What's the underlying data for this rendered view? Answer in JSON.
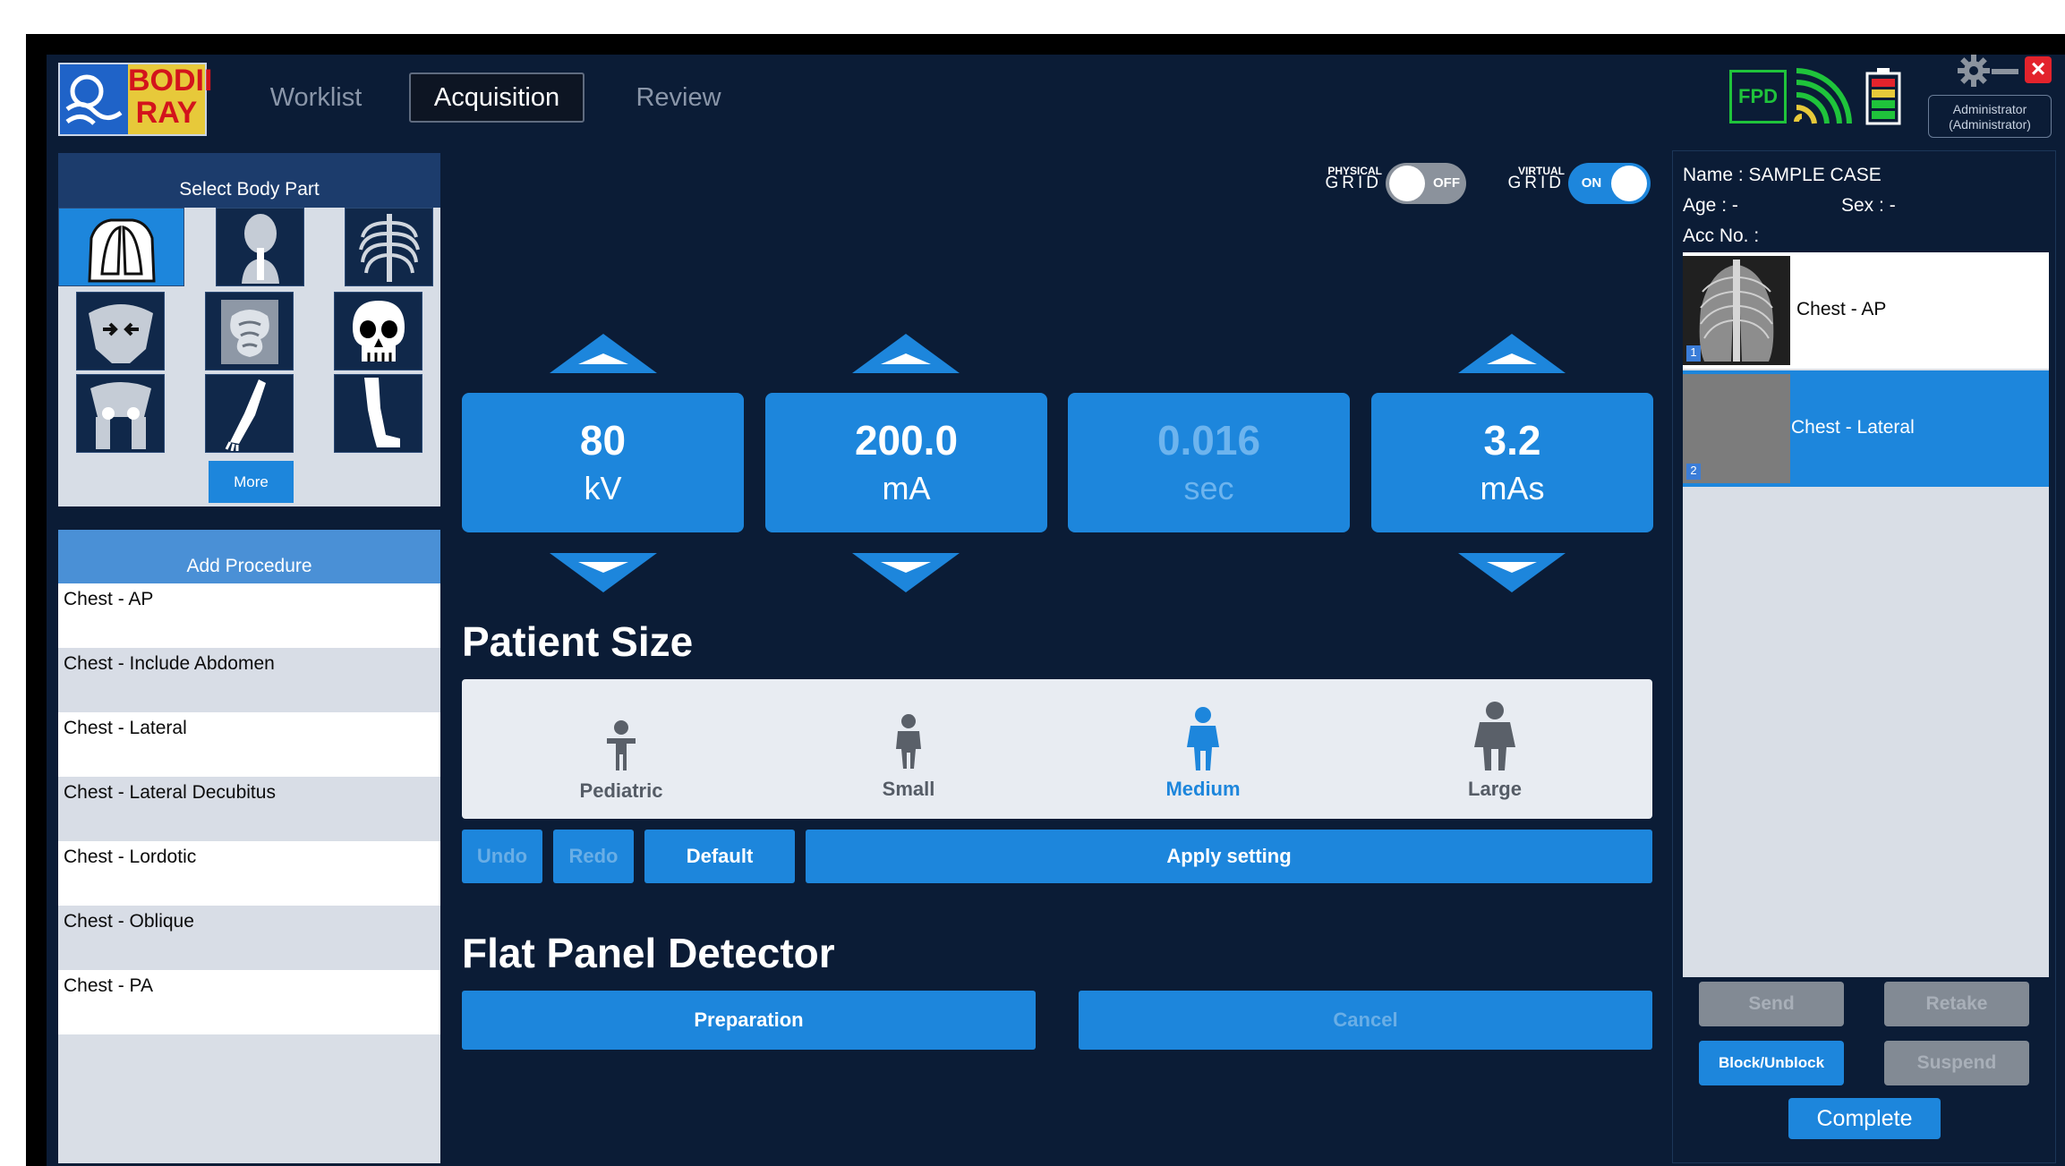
{
  "header": {
    "logo_text_top": "BODII",
    "logo_text_bottom": "RAY",
    "tabs": [
      {
        "label": "Worklist"
      },
      {
        "label": "Acquisition"
      },
      {
        "label": "Review"
      }
    ],
    "fpd_label": "FPD",
    "user_line1": "Administrator",
    "user_line2": "(Administrator)"
  },
  "body_part": {
    "title": "Select Body Part",
    "more_label": "More",
    "parts": [
      "chest",
      "head",
      "spine",
      "pelvis-hip",
      "abdomen",
      "skull",
      "hip",
      "arm",
      "leg"
    ]
  },
  "procedure": {
    "title": "Add Procedure",
    "items": [
      "Chest - AP",
      "Chest - Include Abdomen",
      "Chest - Lateral",
      "Chest - Lateral Decubitus",
      "Chest - Lordotic",
      "Chest - Oblique",
      "Chest - PA"
    ]
  },
  "grid": {
    "physical_small": "PHYSICAL",
    "physical_big": "GRID",
    "physical_state": "OFF",
    "virtual_small": "VIRTUAL",
    "virtual_big": "GRID",
    "virtual_state": "ON"
  },
  "params": [
    {
      "value": "80",
      "unit": "kV"
    },
    {
      "value": "200.0",
      "unit": "mA"
    },
    {
      "value": "0.016",
      "unit": "sec"
    },
    {
      "value": "3.2",
      "unit": "mAs"
    }
  ],
  "patient_size": {
    "title": "Patient Size",
    "options": [
      "Pediatric",
      "Small",
      "Medium",
      "Large"
    ],
    "selected": "Medium"
  },
  "actions": {
    "undo": "Undo",
    "redo": "Redo",
    "default": "Default",
    "apply": "Apply setting"
  },
  "fpd": {
    "title": "Flat Panel Detector",
    "preparation": "Preparation",
    "cancel": "Cancel"
  },
  "patient": {
    "name": "Name : SAMPLE CASE",
    "age": "Age : -",
    "sex": "Sex : -",
    "acc": "Acc No. :"
  },
  "studies": [
    {
      "label": "Chest - AP",
      "index": "1"
    },
    {
      "label": "Chest - Lateral",
      "index": "2"
    }
  ],
  "buttons": {
    "send": "Send",
    "retake": "Retake",
    "block": "Block/Unblock",
    "suspend": "Suspend",
    "complete": "Complete"
  },
  "colors": {
    "accent": "#1d86dc",
    "background": "#0b1c36",
    "fpd_green": "#1fc33b",
    "close_red": "#e3232c"
  }
}
